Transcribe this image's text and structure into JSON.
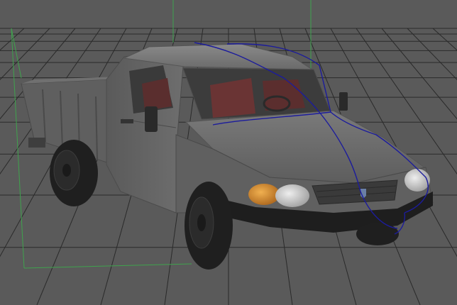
{
  "viewport": {
    "view": "perspective",
    "background_color": "#5a5a5a",
    "grid_color": "#2a2a2a",
    "grid_visible": true,
    "selection_bbox_color": "#3fa34d",
    "selected_curve_color": "#1c1c9c"
  },
  "scene": {
    "object": "pickup-truck",
    "body_color": "#676767",
    "interior_color": "#6a3434",
    "headlight_color": "#c9c9c9",
    "turn_signal_color": "#d08a2a",
    "tire_color": "#1f1f1f",
    "hubcap_color": "#2b2b2b"
  }
}
